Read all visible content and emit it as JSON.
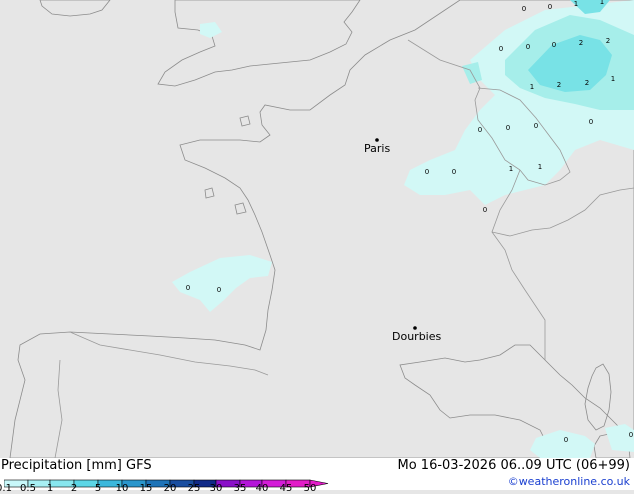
{
  "map": {
    "cities": [
      {
        "name": "Paris"
      },
      {
        "name": "Dourbies"
      }
    ],
    "precip_values": [
      "0",
      "0",
      "1",
      "1",
      "0",
      "0",
      "0",
      "2",
      "2",
      "1",
      "2",
      "2",
      "1",
      "0",
      "0",
      "0",
      "0",
      "1",
      "0",
      "1",
      "0",
      "0",
      "0",
      "0",
      "0",
      "0"
    ]
  },
  "footer": {
    "title": "Precipitation [mm]  GFS",
    "datetime": "Mo 16-03-2026 06..09 UTC (06+99)",
    "credit": "©weatheronline.co.uk",
    "scale_ticks": [
      "0.1",
      "0.5",
      "1",
      "2",
      "5",
      "10",
      "15",
      "20",
      "25",
      "30",
      "35",
      "40",
      "45",
      "50"
    ],
    "scale_colors": [
      "#c8f8fa",
      "#a8f0f4",
      "#88e6ee",
      "#5cd6e6",
      "#3cb8dc",
      "#2a96cc",
      "#1e74b8",
      "#1a4ea0",
      "#102a88",
      "#8a10c8",
      "#b414d8",
      "#d41cd8",
      "#e21cc8"
    ]
  },
  "colors": {
    "sea": "#e6e6e6",
    "land": "#c6f5a2",
    "precip_light": "#d2f8f6",
    "precip_medium": "#a6eeea",
    "precip_heavy": "#78e2e6"
  }
}
